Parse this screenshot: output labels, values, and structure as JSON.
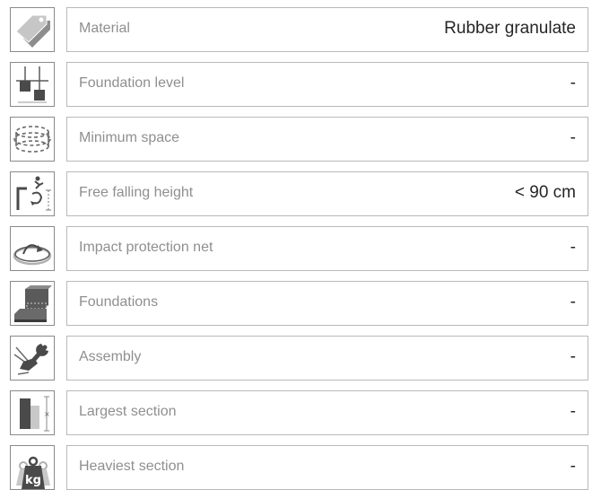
{
  "rows": [
    {
      "icon": "price-tag-icon",
      "label": "Material",
      "value": "Rubber granulate"
    },
    {
      "icon": "foundation-level-icon",
      "label": "Foundation level",
      "value": "-"
    },
    {
      "icon": "minimum-space-icon",
      "label": "Minimum space",
      "value": "-"
    },
    {
      "icon": "free-fall-height-icon",
      "label": "Free falling height",
      "value": "< 90 cm"
    },
    {
      "icon": "impact-net-icon",
      "label": "Impact protection net",
      "value": "-"
    },
    {
      "icon": "foundation-block-icon",
      "label": "Foundations",
      "value": "-"
    },
    {
      "icon": "wrench-assembly-icon",
      "label": "Assembly",
      "value": "-"
    },
    {
      "icon": "section-size-icon",
      "label": "Largest section",
      "value": "-"
    },
    {
      "icon": "weight-kg-icon",
      "label": "Heaviest section",
      "value": "-"
    }
  ],
  "icon_text": {
    "weight_unit": "kg"
  }
}
